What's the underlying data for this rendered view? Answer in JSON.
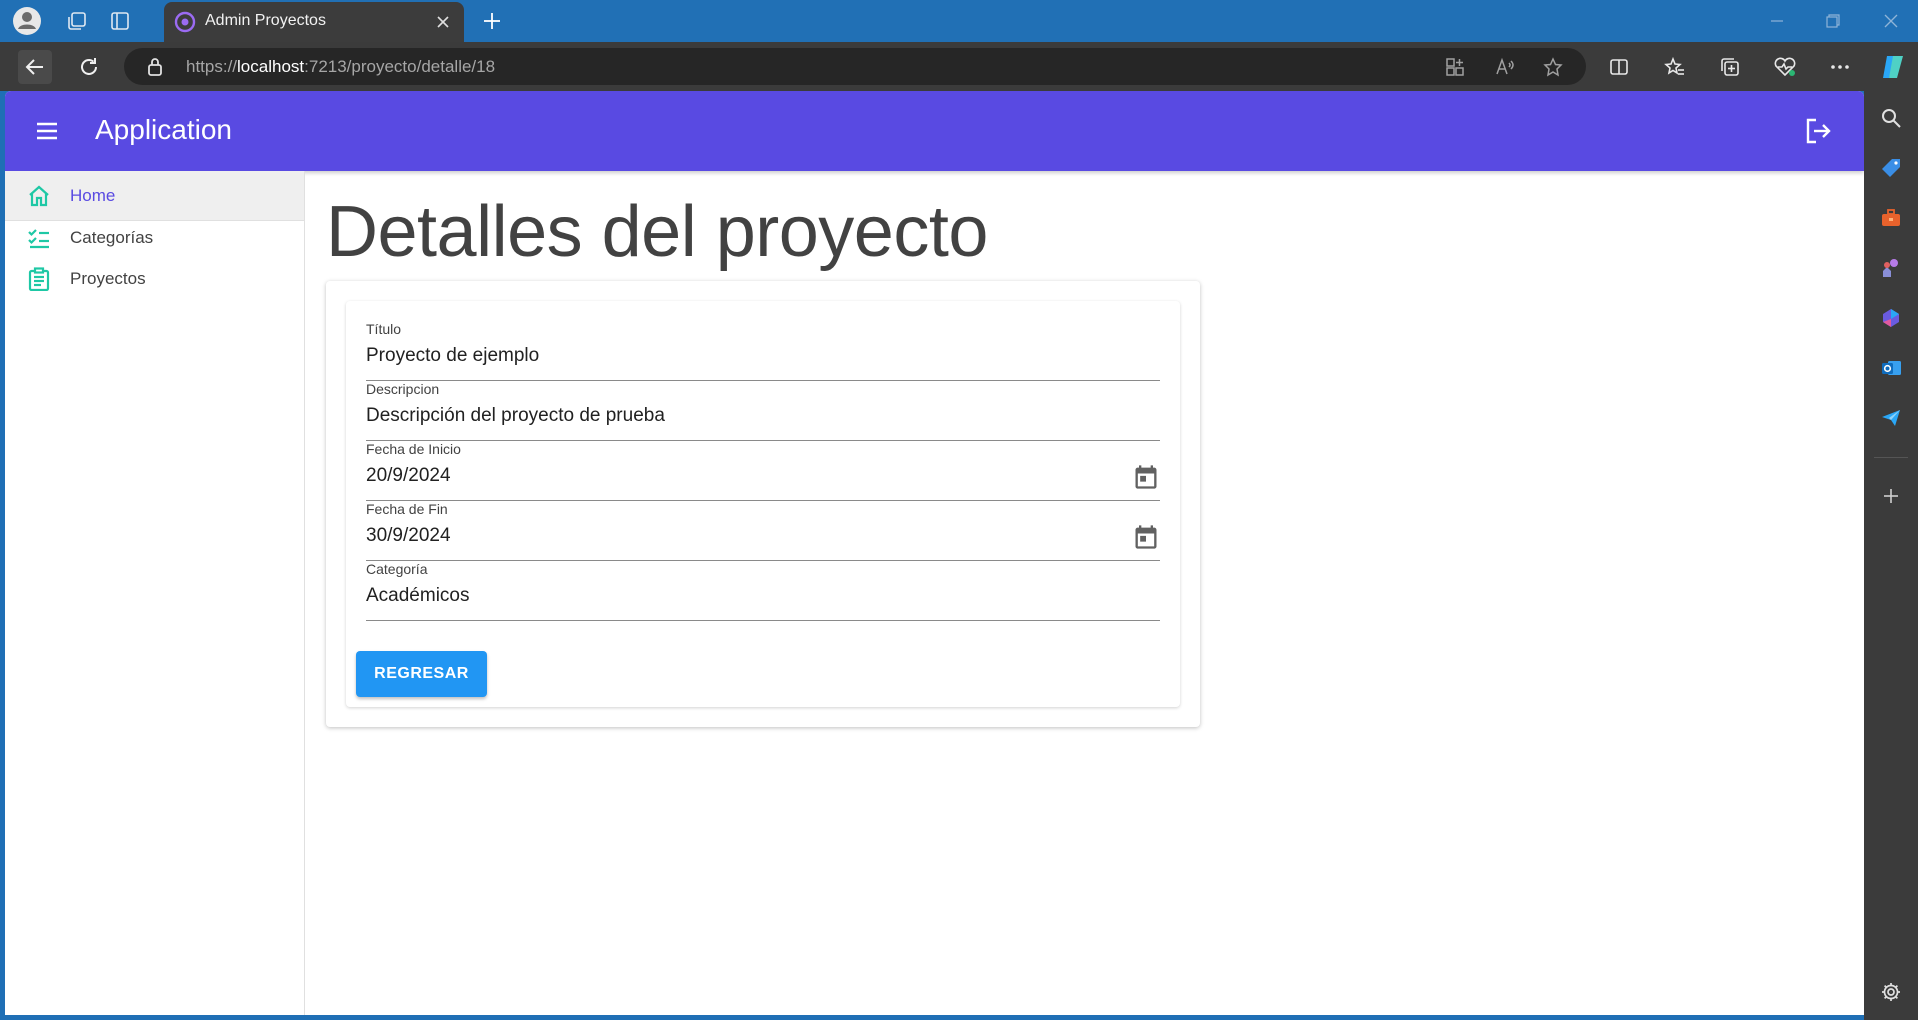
{
  "browser": {
    "tab_title": "Admin Proyectos",
    "url_scheme": "https://",
    "url_host": "localhost",
    "url_rest": ":7213/proyecto/detalle/18"
  },
  "app": {
    "title": "Application",
    "accent": "#594ae2"
  },
  "nav": {
    "items": [
      {
        "label": "Home",
        "icon": "home-icon"
      },
      {
        "label": "Categorías",
        "icon": "checklist-icon"
      },
      {
        "label": "Proyectos",
        "icon": "clipboard-icon"
      }
    ]
  },
  "page": {
    "title": "Detalles del proyecto",
    "fields": [
      {
        "label": "Título",
        "value": "Proyecto de ejemplo"
      },
      {
        "label": "Descripcion",
        "value": "Descripción del proyecto de prueba"
      },
      {
        "label": "Fecha de Inicio",
        "value": "20/9/2024",
        "icon": "calendar-icon"
      },
      {
        "label": "Fecha de Fin",
        "value": "30/9/2024",
        "icon": "calendar-icon"
      },
      {
        "label": "Categoría",
        "value": "Académicos"
      }
    ],
    "back_button": "REGRESAR"
  }
}
